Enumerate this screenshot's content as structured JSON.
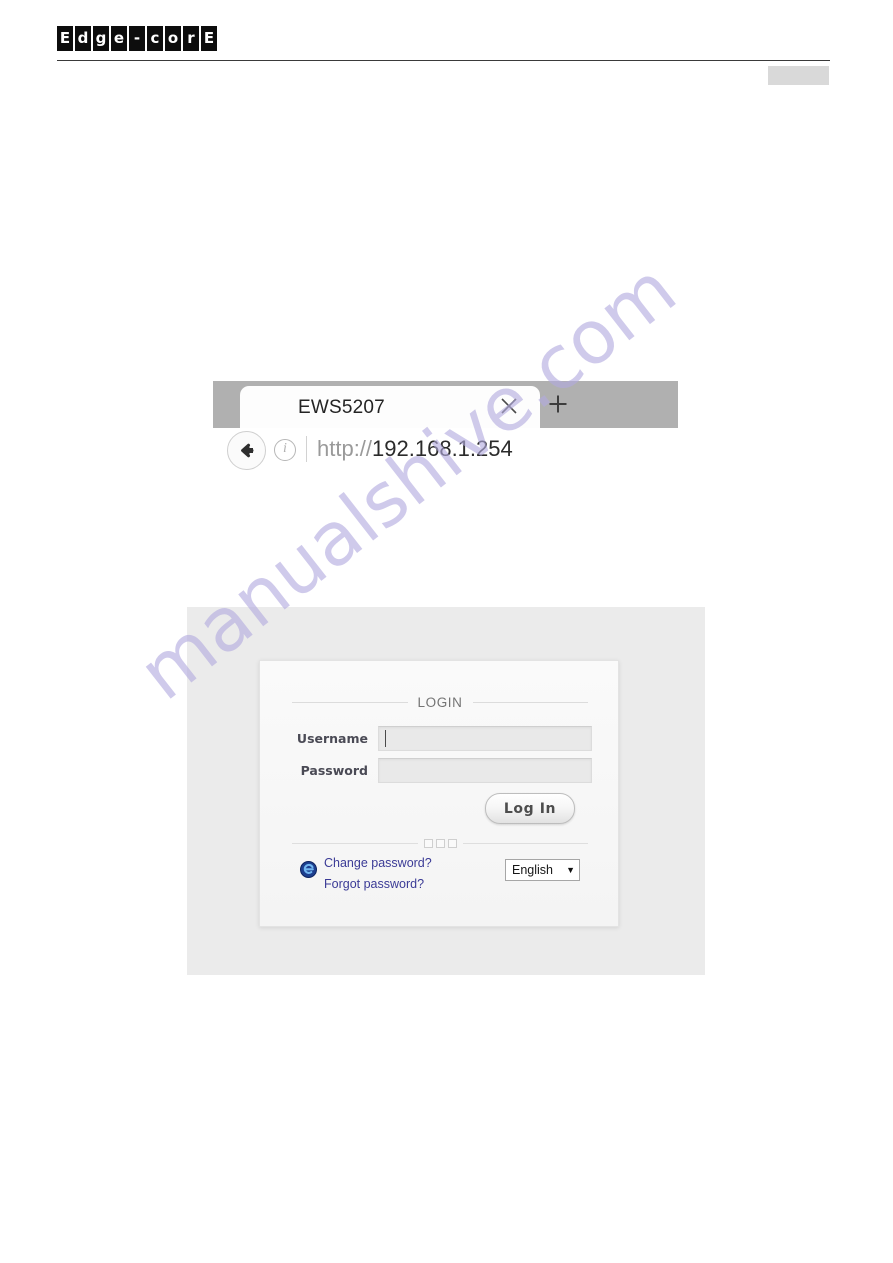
{
  "header": {
    "brand_letters": [
      "E",
      "d",
      "g",
      "e",
      "-",
      "c",
      "o",
      "r",
      "E"
    ],
    "brand_name": "Edge-corE"
  },
  "browser": {
    "tab": {
      "title": "EWS5207",
      "close_icon": "close-icon"
    },
    "new_tab_label": "+",
    "back_icon": "back-arrow-icon",
    "site_info_icon": "info-icon",
    "url": {
      "scheme": "http://",
      "host": "192.168.1.254",
      "full": "http://192.168.1.254"
    }
  },
  "login": {
    "heading": "LOGIN",
    "username": {
      "label": "Username",
      "value": "",
      "placeholder": ""
    },
    "password": {
      "label": "Password",
      "value": "",
      "placeholder": ""
    },
    "submit_label": "Log In",
    "links": [
      {
        "label": "Change password?"
      },
      {
        "label": "Forgot password?"
      }
    ],
    "language": {
      "selected": "English",
      "arrow": "▼",
      "options": [
        "English"
      ]
    },
    "badge_icon": "browser-globe-icon",
    "divider_dots": 3
  },
  "watermark": {
    "text": "manualshive.com",
    "color": "#b3abdf"
  },
  "colors": {
    "brand_black": "#0d0d0d",
    "link_blue": "#3b3b96",
    "panel_bg": "#f7f7f7",
    "screenshot_bg": "#ebebeb",
    "tabstrip_gray": "#b0b0b0"
  }
}
